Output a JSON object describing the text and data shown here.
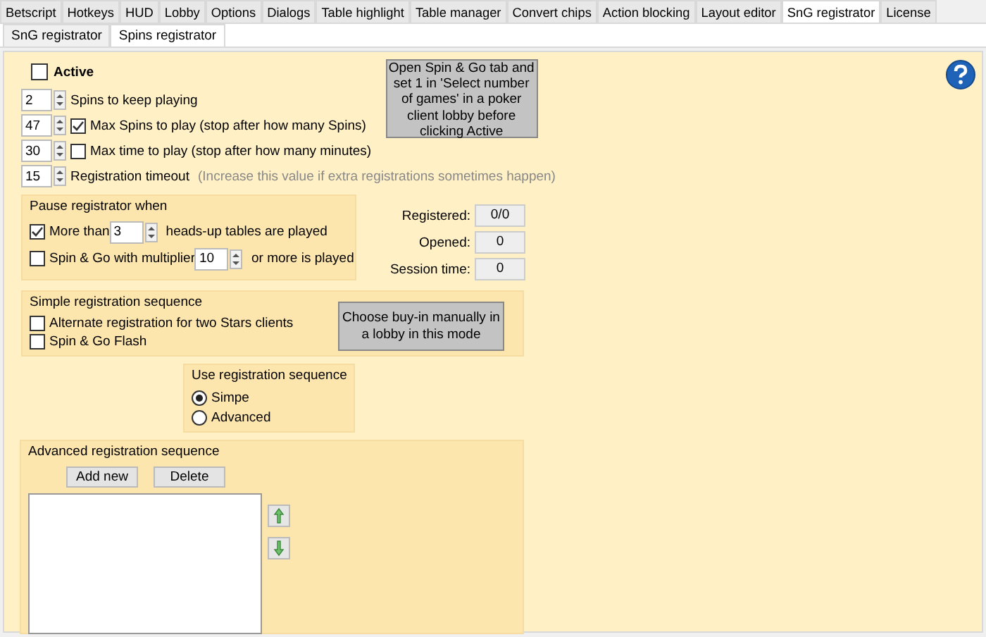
{
  "top_tabs": [
    {
      "label": "Betscript",
      "selected": false
    },
    {
      "label": "Hotkeys",
      "selected": false
    },
    {
      "label": "HUD",
      "selected": false
    },
    {
      "label": "Lobby",
      "selected": false
    },
    {
      "label": "Options",
      "selected": false
    },
    {
      "label": "Dialogs",
      "selected": false
    },
    {
      "label": "Table highlight",
      "selected": false
    },
    {
      "label": "Table manager",
      "selected": false
    },
    {
      "label": "Convert chips",
      "selected": false
    },
    {
      "label": "Action blocking",
      "selected": false
    },
    {
      "label": "Layout editor",
      "selected": false
    },
    {
      "label": "SnG registrator",
      "selected": true
    },
    {
      "label": "License",
      "selected": false
    }
  ],
  "sub_tabs": [
    {
      "label": "SnG registrator",
      "selected": false
    },
    {
      "label": "Spins registrator",
      "selected": true
    }
  ],
  "active": {
    "label": "Active",
    "checked": false
  },
  "settings": [
    {
      "kind": "plain",
      "value": "2",
      "label": "Spins to keep playing"
    },
    {
      "kind": "check",
      "value": "47",
      "label": "Max Spins to play (stop after how many Spins)",
      "checked": true
    },
    {
      "kind": "check",
      "value": "30",
      "label": "Max time to play (stop after how many minutes)",
      "checked": false
    }
  ],
  "timeout": {
    "value": "15",
    "label": "Registration timeout",
    "hint": "(Increase this value if extra registrations sometimes happen)"
  },
  "info_button": "Open Spin & Go tab and set 1 in 'Select number of games' in a poker client lobby before clicking Active",
  "pause_group": {
    "title": "Pause registrator when",
    "rules": [
      {
        "checked": true,
        "before": "More than",
        "value": "3",
        "after": "heads-up tables are played"
      },
      {
        "checked": false,
        "before": "Spin & Go with multiplier",
        "value": "10",
        "after": "or more is played"
      }
    ]
  },
  "stats": [
    {
      "label": "Registered:",
      "value": "0/0"
    },
    {
      "label": "Opened:",
      "value": "0"
    },
    {
      "label": "Session time:",
      "value": "0"
    }
  ],
  "simple_group": {
    "title": "Simple registration sequence",
    "options": [
      {
        "label": "Alternate registration for two Stars clients",
        "checked": false
      },
      {
        "label": "Spin & Go Flash",
        "checked": false
      }
    ],
    "button": "Choose buy-in manually in a lobby in this mode"
  },
  "sequence_group": {
    "title": "Use registration sequence",
    "options": [
      {
        "label": "Simpe",
        "selected": true
      },
      {
        "label": "Advanced",
        "selected": false
      }
    ]
  },
  "advanced_group": {
    "title": "Advanced registration sequence",
    "buttons": [
      "Add new",
      "Delete"
    ]
  }
}
